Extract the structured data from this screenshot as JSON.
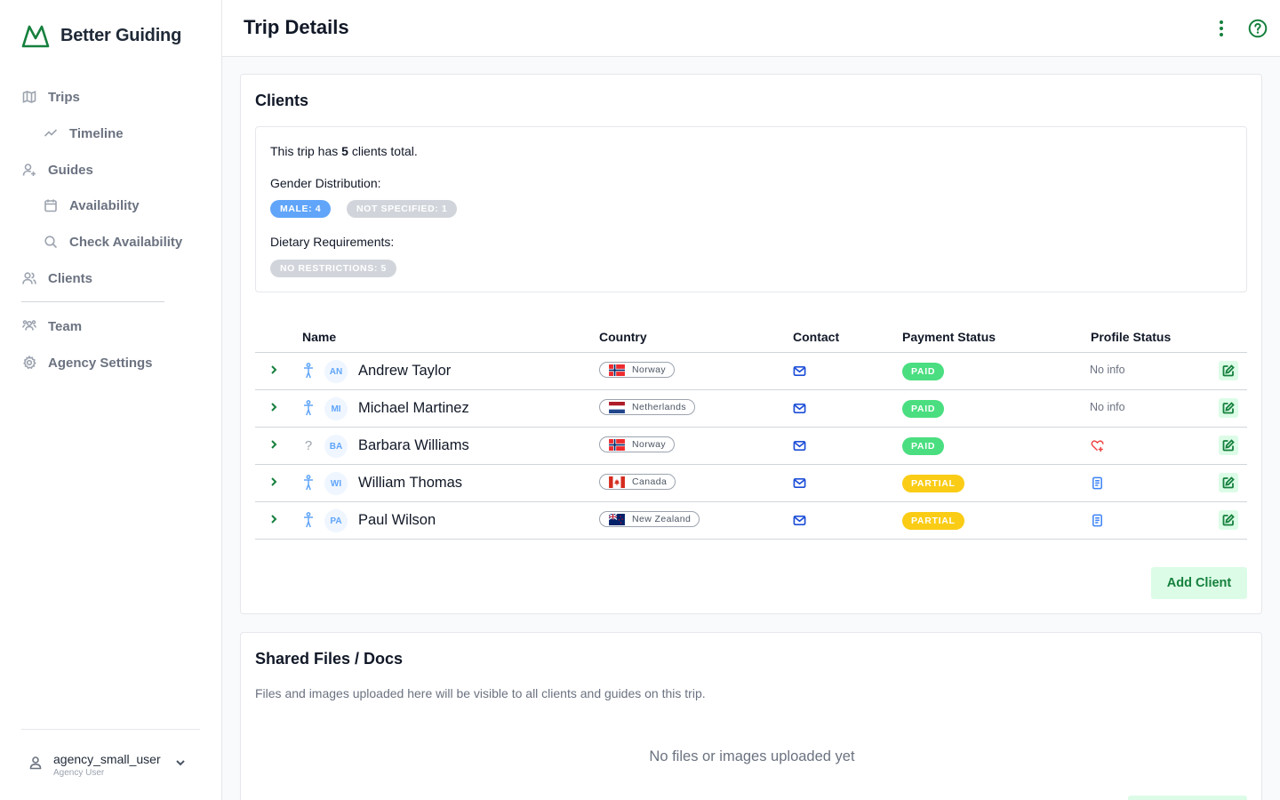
{
  "app": {
    "name": "Better Guiding",
    "brand_color": "#15803d"
  },
  "sidebar": {
    "items": [
      {
        "label": "Trips",
        "icon": "map-icon"
      },
      {
        "label": "Timeline",
        "icon": "trend-icon"
      },
      {
        "label": "Guides",
        "icon": "user-plus-icon"
      },
      {
        "label": "Availability",
        "icon": "calendar-icon"
      },
      {
        "label": "Check Availability",
        "icon": "search-icon"
      },
      {
        "label": "Clients",
        "icon": "users-icon"
      },
      {
        "label": "Team",
        "icon": "team-icon"
      },
      {
        "label": "Agency Settings",
        "icon": "gear-icon"
      }
    ],
    "user": {
      "name": "agency_small_user",
      "role": "Agency User"
    }
  },
  "header": {
    "title": "Trip Details"
  },
  "clients_card": {
    "title": "Clients",
    "summary": {
      "total_prefix": "This trip has",
      "total_count": "5",
      "total_suffix": "clients total.",
      "gender_label": "Gender Distribution:",
      "gender_badges": [
        "MALE: 4",
        "NOT SPECIFIED: 1"
      ],
      "dietary_label": "Dietary Requirements:",
      "dietary_badges": [
        "NO RESTRICTIONS: 5"
      ]
    },
    "columns": [
      "Name",
      "Country",
      "Contact",
      "Payment Status",
      "Profile Status"
    ],
    "rows": [
      {
        "initials": "AN",
        "name": "Andrew Taylor",
        "gender": "male",
        "country": "Norway",
        "payment": "PAID",
        "profile": "No info"
      },
      {
        "initials": "MI",
        "name": "Michael Martinez",
        "gender": "male",
        "country": "Netherlands",
        "payment": "PAID",
        "profile": "No info"
      },
      {
        "initials": "BA",
        "name": "Barbara Williams",
        "gender": "?",
        "country": "Norway",
        "payment": "PAID",
        "profile": "heart-plus-icon"
      },
      {
        "initials": "WI",
        "name": "William Thomas",
        "gender": "male",
        "country": "Canada",
        "payment": "PARTIAL",
        "profile": "document-icon"
      },
      {
        "initials": "PA",
        "name": "Paul Wilson",
        "gender": "male",
        "country": "New Zealand",
        "payment": "PARTIAL",
        "profile": "document-icon"
      }
    ],
    "add_button": "Add Client"
  },
  "files_card": {
    "title": "Shared Files / Docs",
    "description": "Files and images uploaded here will be visible to all clients and guides on this trip.",
    "empty_text": "No files or images uploaded yet"
  },
  "colors": {
    "paid": "#4ade80",
    "partial": "#facc15",
    "male_badge": "#60a5fa",
    "neutral_badge": "#d1d5db"
  }
}
